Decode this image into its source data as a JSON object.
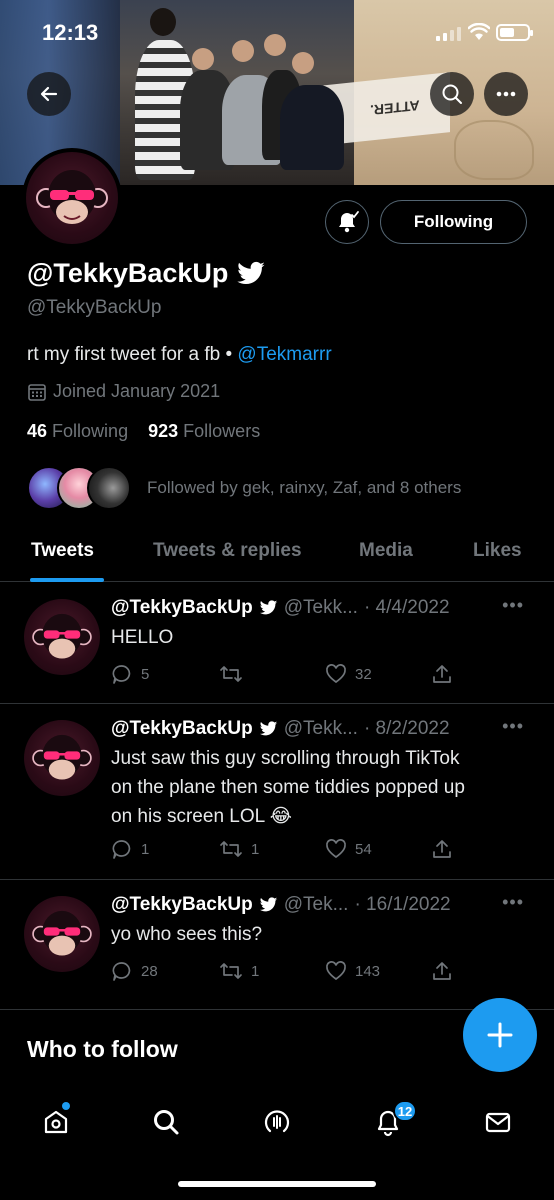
{
  "status_bar": {
    "time": "12:13"
  },
  "banner": {
    "sign_text": "ATTER."
  },
  "profile": {
    "display_name": "@TekkyBackUp",
    "handle": "@TekkyBackUp",
    "bio_text": "rt my first tweet for a fb • ",
    "bio_link": "@Tekmarrr",
    "joined": "Joined January 2021",
    "following_count": "46",
    "following_label": "Following",
    "followers_count": "923",
    "followers_label": "Followers",
    "followed_by": "Followed by gek, rainxy, Zaf, and 8 others",
    "follow_button_label": "Following"
  },
  "tabs": [
    {
      "label": "Tweets",
      "active": true
    },
    {
      "label": "Tweets & replies",
      "active": false
    },
    {
      "label": "Media",
      "active": false
    },
    {
      "label": "Likes",
      "active": false
    }
  ],
  "tweets": [
    {
      "name": "@TekkyBackUp",
      "handle": "@Tekk...",
      "date": "· 4/4/2022",
      "lines": [
        "HELLO"
      ],
      "replies": "5",
      "retweets": "",
      "likes": "32"
    },
    {
      "name": "@TekkyBackUp",
      "handle": "@Tekk...",
      "date": "· 8/2/2022",
      "lines": [
        "Just saw this guy scrolling through TikTok",
        "on the plane then some tiddies popped up",
        "on his screen LOL 😂"
      ],
      "replies": "1",
      "retweets": "1",
      "likes": "54"
    },
    {
      "name": "@TekkyBackUp",
      "handle": "@Tek...",
      "date": "· 16/1/2022",
      "lines": [
        "yo who sees this?"
      ],
      "replies": "28",
      "retweets": "1",
      "likes": "143"
    }
  ],
  "who_to_follow": "Who to follow",
  "notifications_badge": "12",
  "colors": {
    "accent": "#1d9bf0",
    "muted": "#71767b",
    "divider": "#2f3336"
  }
}
